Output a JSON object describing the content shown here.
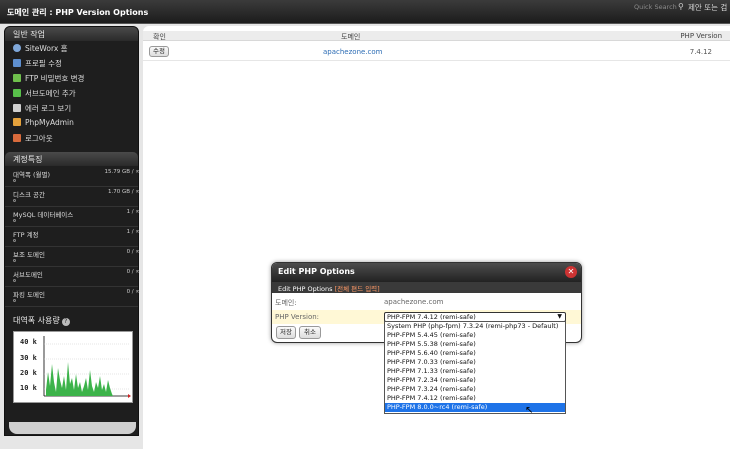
{
  "topbar": {
    "title": "도메인 관리 : PHP Version Options",
    "quick_search_label": "Quick Search",
    "quick_search_text": "제안 또는 검"
  },
  "sidebar": {
    "general_title": "일반 작업",
    "menu": [
      {
        "label": "SiteWorx 홈",
        "icon": "home-icon",
        "color": "#7fa7d9"
      },
      {
        "label": "프로필 수정",
        "icon": "profile-icon",
        "color": "#5e8fcf"
      },
      {
        "label": "FTP 비밀번호 변경",
        "icon": "ftp-user-icon",
        "color": "#6fbf4c"
      },
      {
        "label": "서브도메인 추가",
        "icon": "subdomain-icon",
        "color": "#58c04a"
      },
      {
        "label": "에러 로그 보기",
        "icon": "log-icon",
        "color": "#d0d0d0"
      },
      {
        "label": "PhpMyAdmin",
        "icon": "phpmyadmin-icon",
        "color": "#e5a23c"
      },
      {
        "label": "로그아웃",
        "icon": "logout-icon",
        "color": "#d96b3c"
      }
    ],
    "account_title": "계정특징",
    "stats": [
      {
        "label": "대역폭 (월별)",
        "value": "15.79 GB / ∞"
      },
      {
        "label": "디스크 공간",
        "value": "1.70 GB / ∞"
      },
      {
        "label": "MySQL 데이터베이스",
        "value": "1 / ∞"
      },
      {
        "label": "FTP 계정",
        "value": "1 / ∞"
      },
      {
        "label": "보조 도메인",
        "value": "0 / ∞"
      },
      {
        "label": "서브도메인",
        "value": "0 / ∞"
      },
      {
        "label": "파킹 도메인",
        "value": "0 / ∞"
      }
    ],
    "bandwidth_title": "대역폭 사용량",
    "graph_labels": [
      "40 k",
      "30 k",
      "20 k",
      "10 k"
    ]
  },
  "table": {
    "headers": {
      "confirm": "확인",
      "domain": "도메인",
      "php": "PHP Version"
    },
    "rows": [
      {
        "edit": "수정",
        "domain": "apachezone.com",
        "php": "7.4.12"
      }
    ]
  },
  "dialog": {
    "title": "Edit PHP Options",
    "subtitle_main": "Edit PHP Options",
    "subtitle_warn": "[전체 편드 입력]",
    "domain_label": "도메인:",
    "domain_value": "apachezone.com",
    "php_label": "PHP Version:",
    "php_selected": "PHP-FPM 7.4.12 (remi-safe)",
    "save_label": "저장",
    "cancel_label": "취소"
  },
  "dropdown": {
    "options": [
      "System PHP (php-fpm) 7.3.24 (remi-php73 - Default)",
      "PHP-FPM 5.4.45 (remi-safe)",
      "PHP-FPM 5.5.38 (remi-safe)",
      "PHP-FPM 5.6.40 (remi-safe)",
      "PHP-FPM 7.0.33 (remi-safe)",
      "PHP-FPM 7.1.33 (remi-safe)",
      "PHP-FPM 7.2.34 (remi-safe)",
      "PHP-FPM 7.3.24 (remi-safe)",
      "PHP-FPM 7.4.12 (remi-safe)",
      "PHP-FPM 8.0.0~rc4 (remi-safe)"
    ],
    "highlighted_index": 9
  },
  "colors": {
    "accent": "#1e73e8",
    "link": "#2d6db5",
    "graph_fill": "#3cb34a"
  }
}
